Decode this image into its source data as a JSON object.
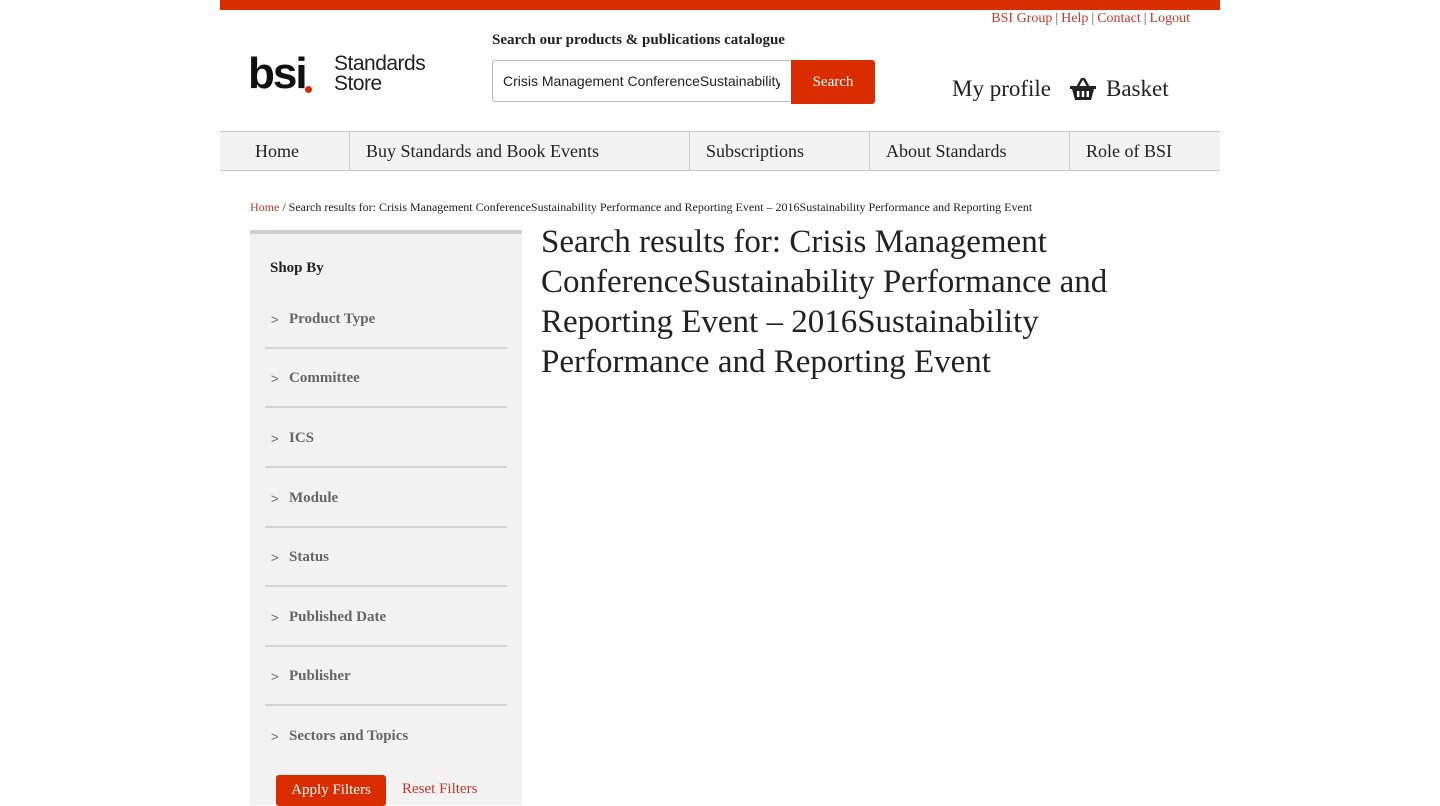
{
  "utility_links": {
    "bsi_group": "BSI Group",
    "help": "Help",
    "contact": "Contact",
    "logout": "Logout",
    "separator": "|"
  },
  "logo": {
    "brand": "bsi",
    "tagline_line1": "Standards",
    "tagline_line2": "Store"
  },
  "search": {
    "label": "Search our products & publications catalogue",
    "value": "Crisis Management ConferenceSustainability",
    "button_label": "Search"
  },
  "header_actions": {
    "my_profile": "My profile",
    "basket": "Basket"
  },
  "nav": {
    "items": [
      {
        "label": "Home"
      },
      {
        "label": "Buy Standards and Book Events"
      },
      {
        "label": "Subscriptions"
      },
      {
        "label": "About Standards"
      },
      {
        "label": "Role of BSI"
      }
    ]
  },
  "breadcrumb": {
    "home": "Home",
    "separator": "/",
    "current": "Search results for: Crisis Management ConferenceSustainability Performance and Reporting Event – 2016Sustainability Performance and Reporting Event"
  },
  "sidebar": {
    "heading": "Shop By",
    "chevron": ">",
    "facets": [
      {
        "label": "Product Type"
      },
      {
        "label": "Committee"
      },
      {
        "label": "ICS"
      },
      {
        "label": "Module"
      },
      {
        "label": "Status"
      },
      {
        "label": "Published Date"
      },
      {
        "label": "Publisher"
      },
      {
        "label": "Sectors and Topics"
      }
    ],
    "apply_label": "Apply Filters",
    "reset_label": "Reset Filters"
  },
  "main": {
    "title": "Search results for: Crisis Management ConferenceSustainability Performance and Reporting Event – 2016Sustainability Performance and Reporting Event"
  },
  "colors": {
    "brand_red": "#d92d00",
    "link_red": "#c0392b",
    "nav_bg": "#f2f2f2"
  }
}
